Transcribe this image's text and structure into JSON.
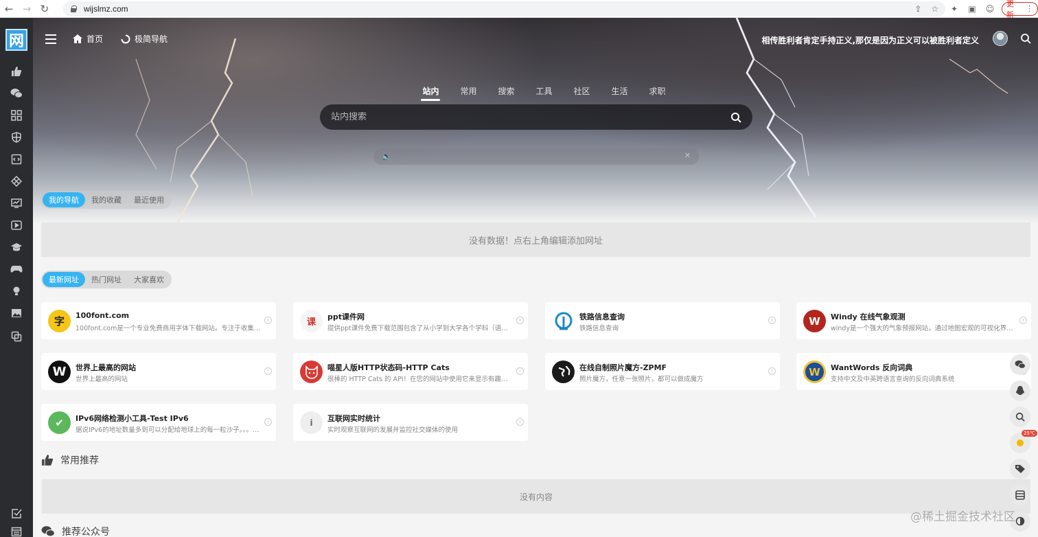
{
  "browser": {
    "url": "wijslmz.com",
    "update_label": "更新"
  },
  "header": {
    "home_label": "首页",
    "nav_label": "极简导航",
    "motto": "相传胜利者肯定手持正义,那仅是因为正义可以被胜利者定义"
  },
  "search": {
    "tabs": [
      "站内",
      "常用",
      "搜索",
      "工具",
      "社区",
      "生活",
      "求职"
    ],
    "placeholder": "站内搜索"
  },
  "my_nav": {
    "tabs": [
      "我的导航",
      "我的收藏",
      "最近使用"
    ],
    "empty_text": "没有数据！点右上角编辑添加网址"
  },
  "site_tabs": [
    "最新网址",
    "热门网址",
    "大家喜欢"
  ],
  "cards": [
    {
      "title": "100font.com",
      "desc": "100font.com是一个专业免费商用字体下载网站。专注于收集整…",
      "icon": "字",
      "icon_bg": "#f5c518",
      "icon_color": "#222"
    },
    {
      "title": "ppt课件网",
      "desc": "提供ppt课件免费下载范围包含了从小学到大学各个学科（语文…",
      "icon": "课",
      "icon_bg": "#f5f5f5",
      "icon_color": "#d0342c"
    },
    {
      "title": "铁路信息查询",
      "desc": "铁路信息查询",
      "icon": "rail-icon",
      "icon_bg": "#ffffff",
      "icon_color": "#1e88c8"
    },
    {
      "title": "Windy 在线气象观测",
      "desc": "windy是一个强大的气象预报网站，通过地图宏观的可视化界面…",
      "icon": "W",
      "icon_bg": "#b3261e",
      "icon_color": "#ffffff"
    },
    {
      "title": "世界上最高的网站",
      "desc": "世界上最高的网站",
      "icon": "W",
      "icon_bg": "#111111",
      "icon_color": "#ffffff"
    },
    {
      "title": "喵星人版HTTP状态码-HTTP Cats",
      "desc": "很棒的 HTTP Cats 的 API！在您的网站中使用它来显示有趣的错…",
      "icon": "cat-icon",
      "icon_bg": "#d63b35",
      "icon_color": "#ffffff"
    },
    {
      "title": "在线自制照片魔方-ZPMF",
      "desc": "照片魔方，任意一张照片，都可以做成魔方",
      "icon": "globe-icon",
      "icon_bg": "#1a1a1a",
      "icon_color": "#ffffff"
    },
    {
      "title": "WantWords 反向词典",
      "desc": "支持中文及中英跨语言查询的反向词典系统",
      "icon": "W",
      "icon_bg": "#1b4f9c",
      "icon_color": "#f2c230"
    },
    {
      "title": "IPv6网络检测小工具-Test IPv6",
      "desc": "据说IPv6的地址数量多到可以分配给地球上的每一粒沙子。。。…",
      "icon": "✔",
      "icon_bg": "#5cb85c",
      "icon_color": "#ffffff"
    },
    {
      "title": "互联网实时统计",
      "desc": "实时观察互联网的发展并监控社交媒体的使用",
      "icon": "i",
      "icon_bg": "#eeeeee",
      "icon_color": "#666666"
    }
  ],
  "sections": {
    "common_title": "常用推荐",
    "common_empty": "没有内容",
    "wechat_title": "推荐公众号"
  },
  "float_tools": {
    "weather": "25℃"
  },
  "watermark": "@稀土掘金技术社区",
  "colors": {
    "accent": "#36b3f2",
    "sidebar_bg": "#2b2c30"
  }
}
